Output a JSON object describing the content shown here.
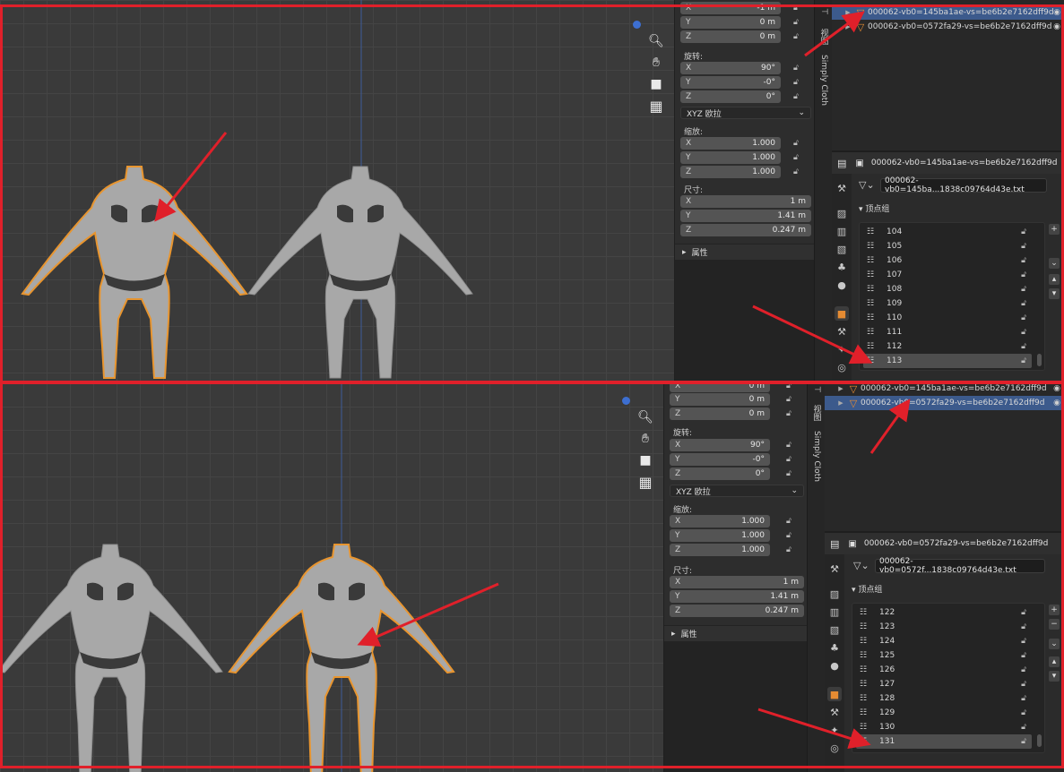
{
  "panels": [
    {
      "id": "top",
      "location": {
        "x": "-1 m",
        "y": "0 m",
        "z": "0 m"
      },
      "rotation_label": "旋转:",
      "rotation": {
        "x": "90°",
        "y": "-0°",
        "z": "0°"
      },
      "rotation_mode": "XYZ 欧拉",
      "scale_label": "缩放:",
      "scale": {
        "x": "1.000",
        "y": "1.000",
        "z": "1.000"
      },
      "dimensions_label": "尺寸:",
      "dimensions": {
        "x": "1 m",
        "y": "1.41 m",
        "z": "0.247 m"
      },
      "properties_section": "属性",
      "outliner": [
        {
          "name": "000062-vb0=145ba1ae-vs=be6b2e7162dff9d",
          "selected": true
        },
        {
          "name": "000062-vb0=0572fa29-vs=be6b2e7162dff9d",
          "selected": false
        }
      ],
      "object_header": "000062-vb0=145ba1ae-vs=be6b2e7162dff9d",
      "mesh_name": "000062-vb0=145ba...1838c09764d43e.txt",
      "vertex_groups_title": "顶点组",
      "vertex_groups": [
        "104",
        "105",
        "106",
        "107",
        "108",
        "109",
        "110",
        "111",
        "112",
        "113"
      ],
      "selected_group": "113"
    },
    {
      "id": "bot",
      "location": {
        "x": "0 m",
        "y": "0 m",
        "z": "0 m"
      },
      "rotation_label": "旋转:",
      "rotation": {
        "x": "90°",
        "y": "-0°",
        "z": "0°"
      },
      "rotation_mode": "XYZ 欧拉",
      "scale_label": "缩放:",
      "scale": {
        "x": "1.000",
        "y": "1.000",
        "z": "1.000"
      },
      "dimensions_label": "尺寸:",
      "dimensions": {
        "x": "1 m",
        "y": "1.41 m",
        "z": "0.247 m"
      },
      "properties_section": "属性",
      "outliner": [
        {
          "name": "000062-vb0=145ba1ae-vs=be6b2e7162dff9d",
          "selected": false
        },
        {
          "name": "000062-vb0=0572fa29-vs=be6b2e7162dff9d",
          "selected": true
        }
      ],
      "object_header": "000062-vb0=0572fa29-vs=be6b2e7162dff9d",
      "mesh_name": "000062-vb0=0572f...1838c09764d43e.txt",
      "vertex_groups_title": "顶点组",
      "vertex_groups": [
        "122",
        "123",
        "124",
        "125",
        "126",
        "127",
        "128",
        "129",
        "130",
        "131"
      ],
      "selected_group": "131"
    }
  ],
  "axis_labels": {
    "x": "X",
    "y": "Y",
    "z": "Z"
  },
  "tab_labels": {
    "view": "视图",
    "simply_cloth": "Simply Cloth"
  },
  "icons": {
    "zoom": "zoom-icon",
    "pan": "hand-icon",
    "camera": "camera-icon",
    "ortho": "grid-icon",
    "lock": "lock-icon",
    "eye": "eye-icon",
    "mesh": "mesh-triangle-icon",
    "vertex_group": "vertex-group-icon"
  },
  "colors": {
    "selection_outline": "#e8952f",
    "annotation_red": "#e0202a",
    "outliner_selected": "#3c5a8c",
    "mesh": "#a9a9a9"
  }
}
